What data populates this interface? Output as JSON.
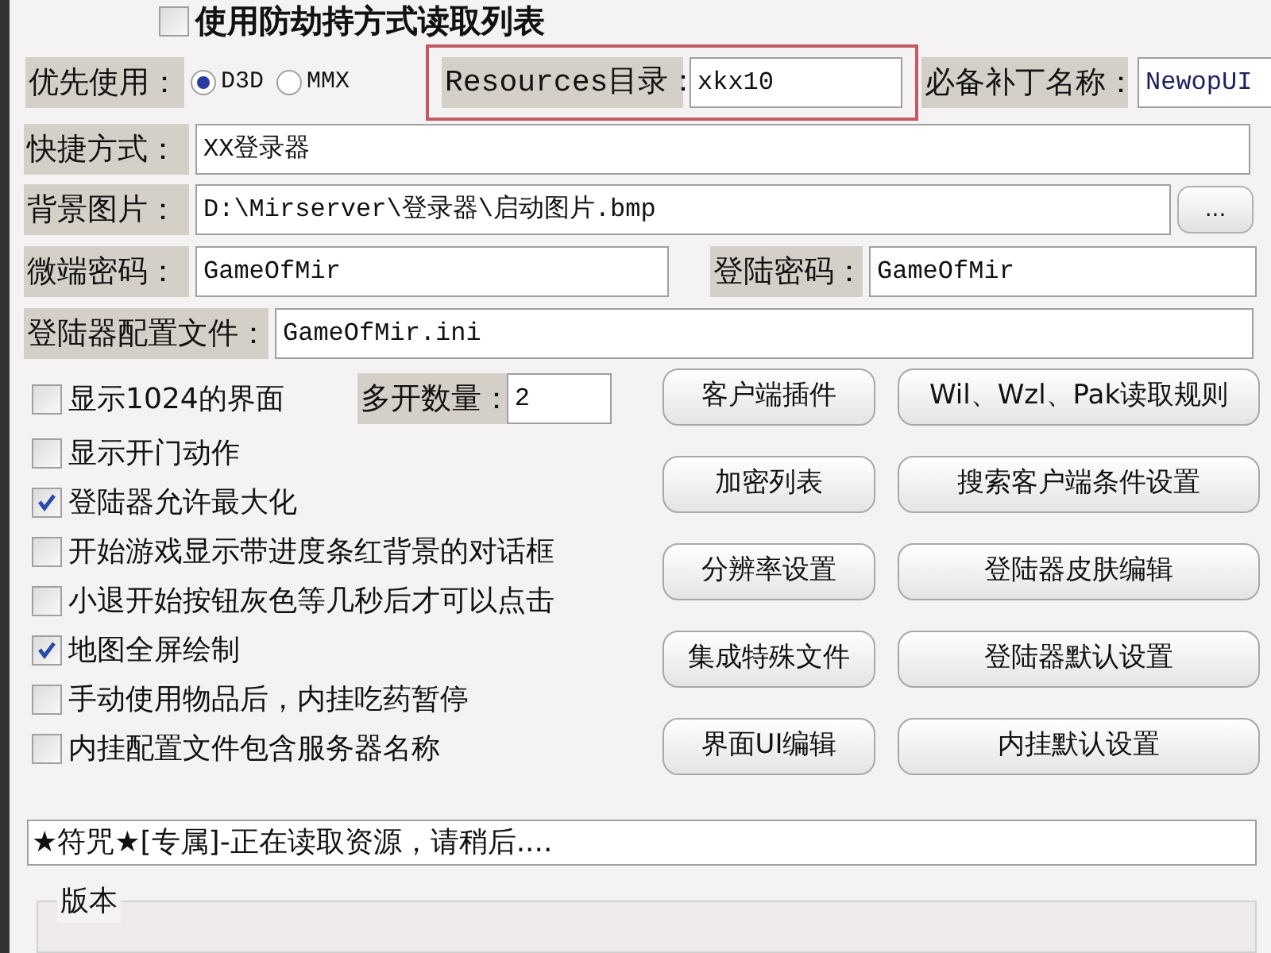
{
  "top_option": {
    "label": "使用防劫持方式读取列表",
    "checked": false
  },
  "render": {
    "label": "优先使用：",
    "options": [
      {
        "label": "D3D",
        "selected": true
      },
      {
        "label": "MMX",
        "selected": false
      }
    ]
  },
  "resources_dir": {
    "label": "Resources目录：",
    "value": "xkx10"
  },
  "patch_name": {
    "label": "必备补丁名称：",
    "value": "NewopUI"
  },
  "shortcut": {
    "label": "快捷方式：",
    "value": "XX登录器"
  },
  "background": {
    "label": "背景图片：",
    "value": "D:\\Mirserver\\登录器\\启动图片.bmp",
    "button": "..."
  },
  "micro_password": {
    "label": "微端密码：",
    "value": "GameOfMir"
  },
  "login_password": {
    "label": "登陆密码：",
    "value": "GameOfMir"
  },
  "config_file": {
    "label": "登陆器配置文件：",
    "value": "GameOfMir.ini"
  },
  "instance_count": {
    "label": "多开数量：",
    "value": "2"
  },
  "options": [
    {
      "label": "显示1024的界面",
      "checked": false
    },
    {
      "label": "显示开门动作",
      "checked": false
    },
    {
      "label": "登陆器允许最大化",
      "checked": true
    },
    {
      "label": "开始游戏显示带进度条红背景的对话框",
      "checked": false
    },
    {
      "label": "小退开始按钮灰色等几秒后才可以点击",
      "checked": false
    },
    {
      "label": "地图全屏绘制",
      "checked": true
    },
    {
      "label": "手动使用物品后，内挂吃药暂停",
      "checked": false
    },
    {
      "label": "内挂配置文件包含服务器名称",
      "checked": false
    }
  ],
  "button_rows": [
    [
      "客户端插件",
      "Wil、Wzl、Pak读取规则"
    ],
    [
      "加密列表",
      "搜索客户端条件设置"
    ],
    [
      "分辨率设置",
      "登陆器皮肤编辑"
    ],
    [
      "集成特殊文件",
      "登陆器默认设置"
    ],
    [
      "界面UI编辑",
      "内挂默认设置"
    ]
  ],
  "status": "★符咒★[专属]-正在读取资源，请稍后....",
  "version_group": {
    "title": "版本"
  }
}
